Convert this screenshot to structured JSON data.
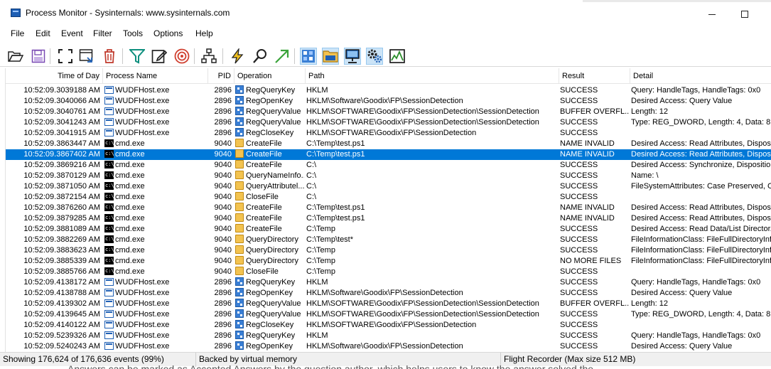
{
  "window": {
    "title": "Process Monitor - Sysinternals: www.sysinternals.com"
  },
  "menu": [
    "File",
    "Edit",
    "Event",
    "Filter",
    "Tools",
    "Options",
    "Help"
  ],
  "toolbar_icons": [
    "open-icon",
    "save-icon",
    "autoscroll-icon",
    "capture-icon",
    "clear-icon",
    "filter-icon",
    "highlight-icon",
    "include-process-icon",
    "process-tree-icon",
    "event-properties-icon",
    "find-icon",
    "jump-icon",
    "registry-activity-icon",
    "file-activity-icon",
    "network-activity-icon",
    "process-activity-icon",
    "profiling-icon"
  ],
  "columns": {
    "time": "Time of Day",
    "process": "Process Name",
    "pid": "PID",
    "operation": "Operation",
    "path": "Path",
    "result": "Result",
    "detail": "Detail"
  },
  "rows": [
    [
      "10:52:09.3039188 AM",
      "WUDFHost.exe",
      "2896",
      "RegQueryKey",
      "HKLM",
      "SUCCESS",
      "Query: HandleTags, HandleTags: 0x0"
    ],
    [
      "10:52:09.3040066 AM",
      "WUDFHost.exe",
      "2896",
      "RegOpenKey",
      "HKLM\\Software\\Goodix\\FP\\SessionDetection",
      "SUCCESS",
      "Desired Access: Query Value"
    ],
    [
      "10:52:09.3040761 AM",
      "WUDFHost.exe",
      "2896",
      "RegQueryValue",
      "HKLM\\SOFTWARE\\Goodix\\FP\\SessionDetection\\SessionDetection",
      "BUFFER OVERFL...",
      "Length: 12"
    ],
    [
      "10:52:09.3041243 AM",
      "WUDFHost.exe",
      "2896",
      "RegQueryValue",
      "HKLM\\SOFTWARE\\Goodix\\FP\\SessionDetection\\SessionDetection",
      "SUCCESS",
      "Type: REG_DWORD, Length: 4, Data: 8"
    ],
    [
      "10:52:09.3041915 AM",
      "WUDFHost.exe",
      "2896",
      "RegCloseKey",
      "HKLM\\SOFTWARE\\Goodix\\FP\\SessionDetection",
      "SUCCESS",
      ""
    ],
    [
      "10:52:09.3863447 AM",
      "cmd.exe",
      "9040",
      "CreateFile",
      "C:\\Temp\\test.ps1",
      "NAME INVALID",
      "Desired Access: Read Attributes, Disposit..."
    ],
    [
      "10:52:09.3867402 AM",
      "cmd.exe",
      "9040",
      "CreateFile",
      "C:\\Temp\\test.ps1",
      "NAME INVALID",
      "Desired Access: Read Attributes, Disposit..."
    ],
    [
      "10:52:09.3869216 AM",
      "cmd.exe",
      "9040",
      "CreateFile",
      "C:\\",
      "SUCCESS",
      "Desired Access: Synchronize, Disposition..."
    ],
    [
      "10:52:09.3870129 AM",
      "cmd.exe",
      "9040",
      "QueryNameInfo...",
      "C:\\",
      "SUCCESS",
      "Name: \\"
    ],
    [
      "10:52:09.3871050 AM",
      "cmd.exe",
      "9040",
      "QueryAttributel...",
      "C:\\",
      "SUCCESS",
      "FileSystemAttributes: Case Preserved, Ca..."
    ],
    [
      "10:52:09.3872154 AM",
      "cmd.exe",
      "9040",
      "CloseFile",
      "C:\\",
      "SUCCESS",
      ""
    ],
    [
      "10:52:09.3876260 AM",
      "cmd.exe",
      "9040",
      "CreateFile",
      "C:\\Temp\\test.ps1",
      "NAME INVALID",
      "Desired Access: Read Attributes, Disposit..."
    ],
    [
      "10:52:09.3879285 AM",
      "cmd.exe",
      "9040",
      "CreateFile",
      "C:\\Temp\\test.ps1",
      "NAME INVALID",
      "Desired Access: Read Attributes, Disposit..."
    ],
    [
      "10:52:09.3881089 AM",
      "cmd.exe",
      "9040",
      "CreateFile",
      "C:\\Temp",
      "SUCCESS",
      "Desired Access: Read Data/List Director..."
    ],
    [
      "10:52:09.3882269 AM",
      "cmd.exe",
      "9040",
      "QueryDirectory",
      "C:\\Temp\\test*",
      "SUCCESS",
      "FileInformationClass: FileFullDirectoryInfor..."
    ],
    [
      "10:52:09.3883623 AM",
      "cmd.exe",
      "9040",
      "QueryDirectory",
      "C:\\Temp",
      "SUCCESS",
      "FileInformationClass: FileFullDirectoryInfor..."
    ],
    [
      "10:52:09.3885339 AM",
      "cmd.exe",
      "9040",
      "QueryDirectory",
      "C:\\Temp",
      "NO MORE FILES",
      "FileInformationClass: FileFullDirectoryInfor..."
    ],
    [
      "10:52:09.3885766 AM",
      "cmd.exe",
      "9040",
      "CloseFile",
      "C:\\Temp",
      "SUCCESS",
      ""
    ],
    [
      "10:52:09.4138172 AM",
      "WUDFHost.exe",
      "2896",
      "RegQueryKey",
      "HKLM",
      "SUCCESS",
      "Query: HandleTags, HandleTags: 0x0"
    ],
    [
      "10:52:09.4138788 AM",
      "WUDFHost.exe",
      "2896",
      "RegOpenKey",
      "HKLM\\Software\\Goodix\\FP\\SessionDetection",
      "SUCCESS",
      "Desired Access: Query Value"
    ],
    [
      "10:52:09.4139302 AM",
      "WUDFHost.exe",
      "2896",
      "RegQueryValue",
      "HKLM\\SOFTWARE\\Goodix\\FP\\SessionDetection\\SessionDetection",
      "BUFFER OVERFL...",
      "Length: 12"
    ],
    [
      "10:52:09.4139645 AM",
      "WUDFHost.exe",
      "2896",
      "RegQueryValue",
      "HKLM\\SOFTWARE\\Goodix\\FP\\SessionDetection\\SessionDetection",
      "SUCCESS",
      "Type: REG_DWORD, Length: 4, Data: 8"
    ],
    [
      "10:52:09.4140122 AM",
      "WUDFHost.exe",
      "2896",
      "RegCloseKey",
      "HKLM\\SOFTWARE\\Goodix\\FP\\SessionDetection",
      "SUCCESS",
      ""
    ],
    [
      "10:52:09.5239326 AM",
      "WUDFHost.exe",
      "2896",
      "RegQueryKey",
      "HKLM",
      "SUCCESS",
      "Query: HandleTags, HandleTags: 0x0"
    ],
    [
      "10:52:09.5240243 AM",
      "WUDFHost.exe",
      "2896",
      "RegOpenKey",
      "HKLM\\Software\\Goodix\\FP\\SessionDetection",
      "SUCCESS",
      "Desired Access: Query Value"
    ]
  ],
  "selected_row": 6,
  "status": {
    "events": "Showing 176,624 of 176,636 events (99%)",
    "memory": "Backed by virtual memory",
    "recorder": "Flight Recorder (Max size 512 MB)"
  },
  "background_text": "Answers can be marked as Accepted Answers by the question author, which helps users to know the answer solved the",
  "colors": {
    "selection": "#0078d7",
    "pressed": "#cce4f7"
  }
}
